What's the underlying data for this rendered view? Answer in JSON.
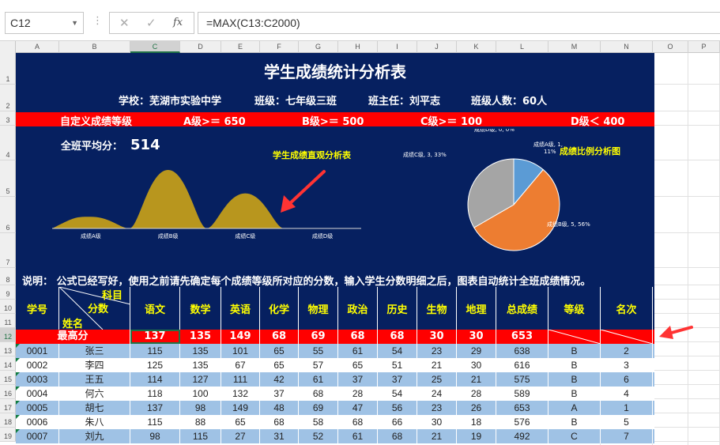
{
  "formula_bar": {
    "cell_ref": "C12",
    "cancel_icon": "✕",
    "confirm_icon": "✓",
    "fx_label": "fx",
    "formula": "=MAX(C13:C2000)"
  },
  "columns": [
    "A",
    "B",
    "C",
    "D",
    "E",
    "F",
    "G",
    "H",
    "I",
    "J",
    "K",
    "L",
    "M",
    "N",
    "O",
    "P"
  ],
  "selected_column": "C",
  "rows": [
    "1",
    "2",
    "3",
    "4",
    "5",
    "6",
    "7",
    "8",
    "9",
    "10",
    "11",
    "12",
    "13",
    "14",
    "15",
    "16",
    "17",
    "18",
    "19"
  ],
  "selected_row": "12",
  "sheet": {
    "title": "学生成绩统计分析表",
    "school": "学校：芜湖市实验中学",
    "class": "班级：七年级三班",
    "teacher": "班主任：刘平志",
    "class_size": "班级人数：60人",
    "grade_levels": {
      "label": "自定义成绩等级",
      "a": "A级>＝ 650",
      "b": "B级>＝ 500",
      "c": "C级>＝ 100",
      "d": "D级＜ 400"
    },
    "average_label": "全班平均分：",
    "average_value": "514",
    "note": "说明：  公式已经写好，使用之前请先确定每个成绩等级所对应的分数，输入学生分数明细之后，图表自动统计全班成绩情况。"
  },
  "chart_data": [
    {
      "type": "area",
      "title": "学生成绩直观分析表",
      "categories": [
        "成绩A级",
        "成绩B级",
        "成绩C级",
        "成绩D级"
      ],
      "values": [
        1,
        5,
        3,
        0
      ],
      "color": "#b8961e"
    },
    {
      "type": "pie",
      "title": "成绩比例分析图",
      "slices": [
        {
          "label": "成绩A级, 1, 11%",
          "value": 1,
          "color": "#5b9bd5"
        },
        {
          "label": "成绩B级, 5, 56%",
          "value": 5,
          "color": "#ed7d31"
        },
        {
          "label": "成绩C级, 3, 33%",
          "value": 3,
          "color": "#a5a5a5"
        },
        {
          "label": "成绩D级, 0, 0%",
          "value": 0,
          "color": "#ffc000"
        }
      ]
    }
  ],
  "table": {
    "headers": {
      "id": "学号",
      "diag_subject": "科目",
      "diag_score": "分数",
      "diag_name": "姓名",
      "subjects": [
        "语文",
        "数学",
        "英语",
        "化学",
        "物理",
        "政治",
        "历史",
        "生物",
        "地理",
        "总成绩",
        "等级",
        "名次"
      ]
    },
    "max_row": {
      "label": "最高分",
      "values": [
        "137",
        "135",
        "149",
        "68",
        "69",
        "68",
        "68",
        "30",
        "30",
        "653"
      ]
    },
    "rows": [
      {
        "id": "0001",
        "name": "张三",
        "scores": [
          "115",
          "135",
          "101",
          "65",
          "55",
          "61",
          "54",
          "23",
          "29"
        ],
        "total": "638",
        "grade": "B",
        "rank": "2"
      },
      {
        "id": "0002",
        "name": "李四",
        "scores": [
          "125",
          "135",
          "67",
          "65",
          "57",
          "65",
          "51",
          "21",
          "30"
        ],
        "total": "616",
        "grade": "B",
        "rank": "3"
      },
      {
        "id": "0003",
        "name": "王五",
        "scores": [
          "114",
          "127",
          "111",
          "42",
          "61",
          "37",
          "37",
          "25",
          "21"
        ],
        "total": "575",
        "grade": "B",
        "rank": "6"
      },
      {
        "id": "0004",
        "name": "何六",
        "scores": [
          "118",
          "100",
          "132",
          "37",
          "68",
          "28",
          "54",
          "24",
          "28"
        ],
        "total": "589",
        "grade": "B",
        "rank": "4"
      },
      {
        "id": "0005",
        "name": "胡七",
        "scores": [
          "137",
          "98",
          "149",
          "48",
          "69",
          "47",
          "56",
          "23",
          "26"
        ],
        "total": "653",
        "grade": "A",
        "rank": "1"
      },
      {
        "id": "0006",
        "name": "朱八",
        "scores": [
          "115",
          "88",
          "65",
          "68",
          "58",
          "68",
          "66",
          "30",
          "18"
        ],
        "total": "576",
        "grade": "B",
        "rank": "5"
      },
      {
        "id": "0007",
        "name": "刘九",
        "scores": [
          "98",
          "115",
          "27",
          "31",
          "52",
          "61",
          "68",
          "21",
          "19"
        ],
        "total": "492",
        "grade": "C",
        "rank": "7"
      }
    ]
  }
}
